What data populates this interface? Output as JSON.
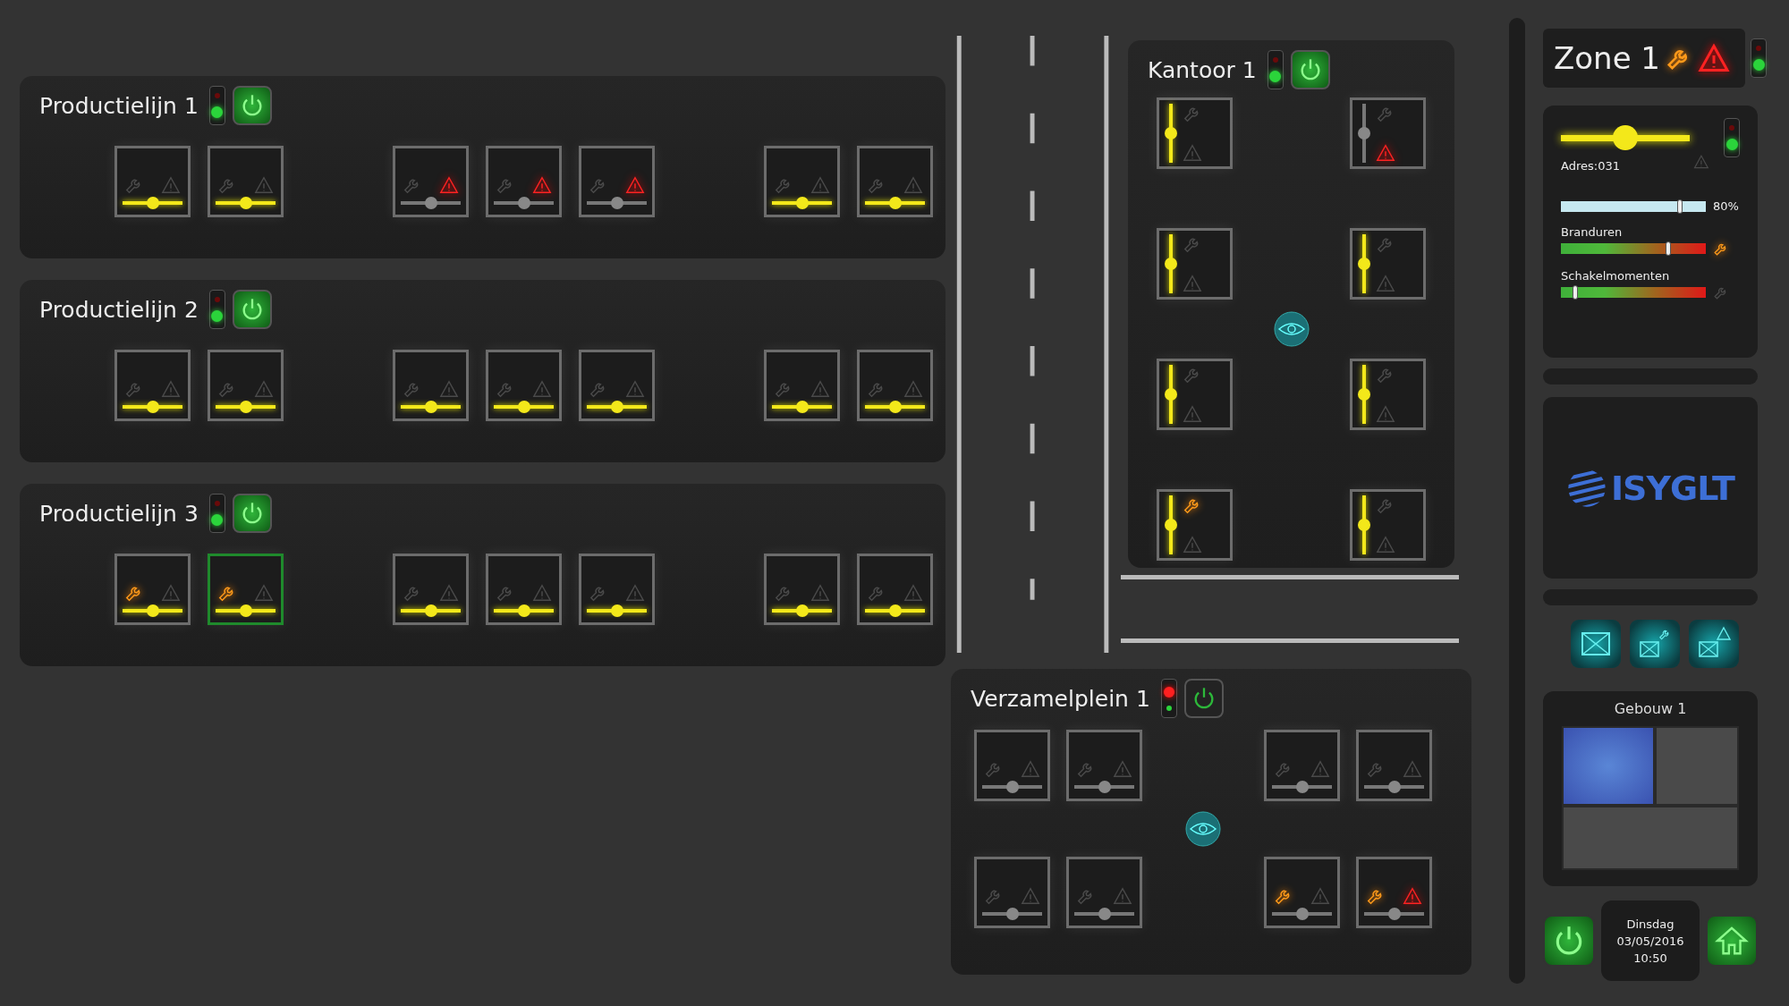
{
  "lines": [
    {
      "title": "Productielijn 1",
      "alarm": false,
      "power_on": true,
      "groups": [
        {
          "fixtures": [
            {
              "on": true,
              "service": false,
              "fault": false,
              "selected": false,
              "level": 0.5
            },
            {
              "on": true,
              "service": false,
              "fault": false,
              "selected": false,
              "level": 0.5
            }
          ]
        },
        {
          "fixtures": [
            {
              "on": false,
              "service": false,
              "fault": true,
              "selected": false,
              "level": 0.5
            },
            {
              "on": false,
              "service": false,
              "fault": true,
              "selected": false,
              "level": 0.5
            },
            {
              "on": false,
              "service": false,
              "fault": true,
              "selected": false,
              "level": 0.5
            }
          ]
        },
        {
          "fixtures": [
            {
              "on": true,
              "service": false,
              "fault": false,
              "selected": false,
              "level": 0.5
            },
            {
              "on": true,
              "service": false,
              "fault": false,
              "selected": false,
              "level": 0.5
            }
          ]
        }
      ]
    },
    {
      "title": "Productielijn 2",
      "alarm": false,
      "power_on": true,
      "groups": [
        {
          "fixtures": [
            {
              "on": true,
              "service": false,
              "fault": false,
              "selected": false,
              "level": 0.5
            },
            {
              "on": true,
              "service": false,
              "fault": false,
              "selected": false,
              "level": 0.5
            }
          ]
        },
        {
          "fixtures": [
            {
              "on": true,
              "service": false,
              "fault": false,
              "selected": false,
              "level": 0.5
            },
            {
              "on": true,
              "service": false,
              "fault": false,
              "selected": false,
              "level": 0.5
            },
            {
              "on": true,
              "service": false,
              "fault": false,
              "selected": false,
              "level": 0.5
            }
          ]
        },
        {
          "fixtures": [
            {
              "on": true,
              "service": false,
              "fault": false,
              "selected": false,
              "level": 0.5
            },
            {
              "on": true,
              "service": false,
              "fault": false,
              "selected": false,
              "level": 0.5
            }
          ]
        }
      ]
    },
    {
      "title": "Productielijn 3",
      "alarm": false,
      "power_on": true,
      "groups": [
        {
          "fixtures": [
            {
              "on": true,
              "service": true,
              "fault": false,
              "selected": false,
              "level": 0.5
            },
            {
              "on": true,
              "service": true,
              "fault": false,
              "selected": true,
              "level": 0.5
            }
          ]
        },
        {
          "fixtures": [
            {
              "on": true,
              "service": false,
              "fault": false,
              "selected": false,
              "level": 0.5
            },
            {
              "on": true,
              "service": false,
              "fault": false,
              "selected": false,
              "level": 0.5
            },
            {
              "on": true,
              "service": false,
              "fault": false,
              "selected": false,
              "level": 0.5
            }
          ]
        },
        {
          "fixtures": [
            {
              "on": true,
              "service": false,
              "fault": false,
              "selected": false,
              "level": 0.5
            },
            {
              "on": true,
              "service": false,
              "fault": false,
              "selected": false,
              "level": 0.5
            }
          ]
        }
      ]
    }
  ],
  "office": {
    "title": "Kantoor 1",
    "alarm": false,
    "power_on": true,
    "fixtures": [
      {
        "on": true,
        "service": false,
        "fault": false,
        "selected": false,
        "level": 0.5
      },
      {
        "on": false,
        "service": false,
        "fault": true,
        "selected": false,
        "level": 0.5
      },
      {
        "on": true,
        "service": false,
        "fault": false,
        "selected": false,
        "level": 0.5
      },
      {
        "on": true,
        "service": false,
        "fault": false,
        "selected": false,
        "level": 0.5
      },
      {
        "on": true,
        "service": false,
        "fault": false,
        "selected": false,
        "level": 0.5
      },
      {
        "on": true,
        "service": false,
        "fault": false,
        "selected": false,
        "level": 0.5
      },
      {
        "on": true,
        "service": true,
        "fault": false,
        "selected": false,
        "level": 0.5
      },
      {
        "on": true,
        "service": false,
        "fault": false,
        "selected": false,
        "level": 0.5
      }
    ]
  },
  "square": {
    "title": "Verzamelplein 1",
    "alarm": true,
    "power_on": false,
    "fixtures": [
      {
        "on": false,
        "service": false,
        "fault": false,
        "selected": false,
        "level": 0.5
      },
      {
        "on": false,
        "service": false,
        "fault": false,
        "selected": false,
        "level": 0.5
      },
      {
        "on": false,
        "service": false,
        "fault": false,
        "selected": false,
        "level": 0.5
      },
      {
        "on": false,
        "service": false,
        "fault": false,
        "selected": false,
        "level": 0.5
      },
      {
        "on": false,
        "service": false,
        "fault": false,
        "selected": false,
        "level": 0.5
      },
      {
        "on": false,
        "service": false,
        "fault": false,
        "selected": false,
        "level": 0.5
      },
      {
        "on": false,
        "service": true,
        "fault": false,
        "selected": false,
        "level": 0.5
      },
      {
        "on": false,
        "service": true,
        "fault": true,
        "selected": false,
        "level": 0.5
      }
    ]
  },
  "zone": {
    "title": "Zone 1",
    "service": true,
    "fault": true,
    "alarm": false
  },
  "detail": {
    "on": true,
    "level": 0.5,
    "fault": false,
    "alarm": false,
    "address": "Adres:031",
    "dimmer": {
      "level": 0.82,
      "reading": "80%"
    },
    "meters": [
      {
        "label": "Branduren",
        "level": 0.74,
        "service": true
      },
      {
        "label": "Schakelmomenten",
        "level": 0.1,
        "service": false
      }
    ]
  },
  "logo": "ISYGLT",
  "building": {
    "title": "Gebouw 1",
    "rooms": [
      {
        "selected": true
      },
      {
        "selected": false
      },
      {
        "selected": false
      }
    ]
  },
  "clock": {
    "day": "Dinsdag",
    "date": "03/05/2016",
    "time": "10:50"
  }
}
